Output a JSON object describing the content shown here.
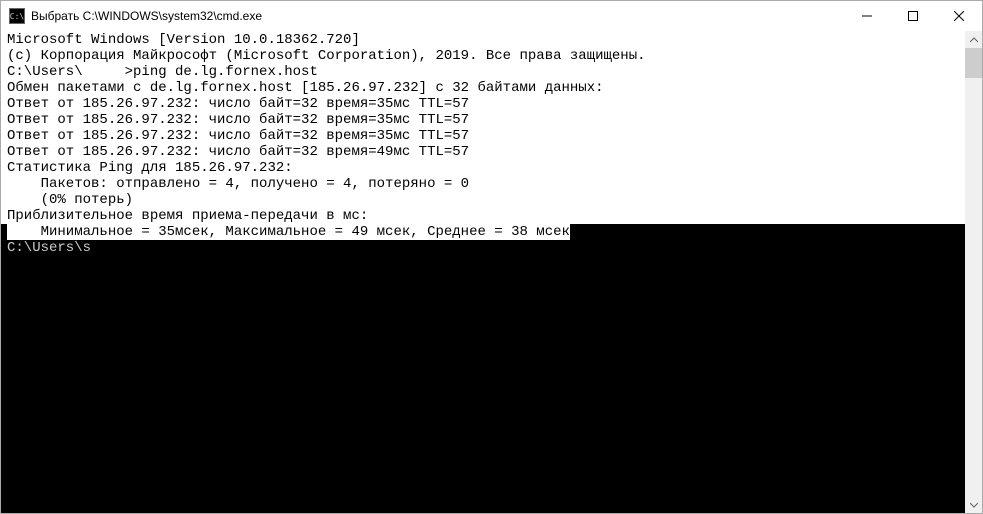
{
  "window": {
    "title": "Выбрать C:\\WINDOWS\\system32\\cmd.exe"
  },
  "terminal": {
    "header1": "Microsoft Windows [Version 10.0.18362.720]",
    "header2": "(c) Корпорация Майкрософт (Microsoft Corporation), 2019. Все права защищены.",
    "blank1": "",
    "prompt_line1": "C:\\Users\\     >ping de.lg.fornex.host",
    "blank2": "",
    "exchange": "Обмен пакетами с de.lg.fornex.host [185.26.97.232] с 32 байтами данных:",
    "reply1": "Ответ от 185.26.97.232: число байт=32 время=35мс TTL=57",
    "reply2": "Ответ от 185.26.97.232: число байт=32 время=35мс TTL=57",
    "reply3": "Ответ от 185.26.97.232: число байт=32 время=35мс TTL=57",
    "reply4": "Ответ от 185.26.97.232: число байт=32 время=49мс TTL=57",
    "blank3": "",
    "stats_head": "Статистика Ping для 185.26.97.232:",
    "packets": "    Пакетов: отправлено = 4, получено = 4, потеряно = 0",
    "loss": "    (0% потерь)",
    "approx": "Приблизительное время приема-передачи в мс:",
    "minmax": "    Минимальное = 35мсек, Максимальное = 49 мсек, Среднее = 38 мсек",
    "blank4": "",
    "prompt2": "C:\\Users\\s"
  }
}
